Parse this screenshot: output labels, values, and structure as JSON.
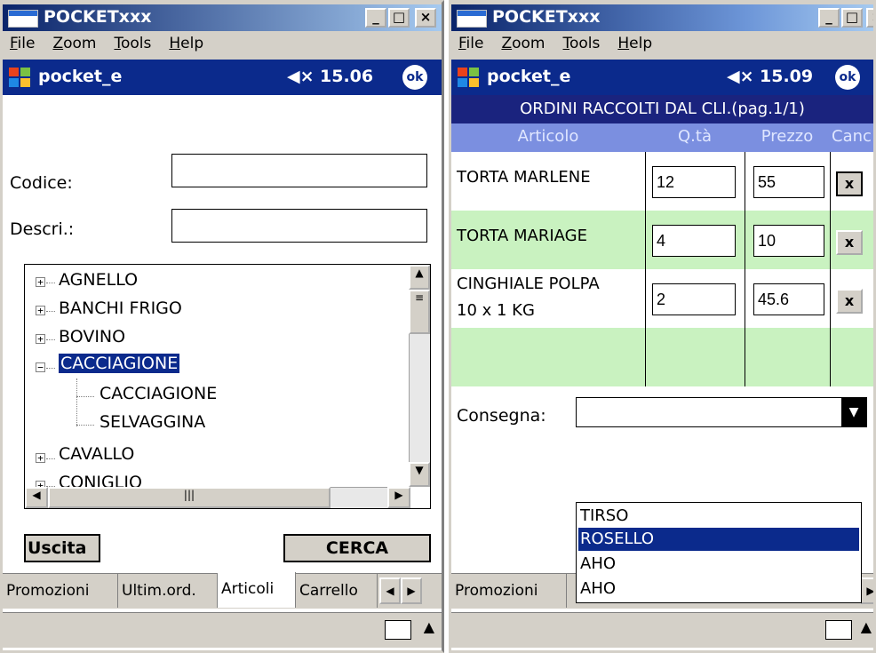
{
  "left": {
    "window_title": "POCKETxxx",
    "menu": [
      "File",
      "Zoom",
      "Tools",
      "Help"
    ],
    "app_name": "pocket_e",
    "clock": "15.06",
    "ok_label": "ok",
    "codice_label": "Codice:",
    "descr_label": "Descri.:",
    "codice_value": "",
    "descr_value": "",
    "tree": {
      "agnello": "AGNELLO",
      "banchi": "BANCHI FRIGO",
      "bovino": "BOVINO",
      "cacciagione": "CACCIAGIONE",
      "child_cacciagione": "CACCIAGIONE",
      "child_selvaggina": "SELVAGGINA",
      "cavallo": "CAVALLO",
      "coniglio": "CONIGLIO"
    },
    "uscita_label": "Uscita",
    "cerca_label": "CERCA",
    "tabs": [
      "Promozioni",
      "Ultim.ord.",
      "Articoli",
      "Carrello"
    ],
    "active_tab": "Articoli"
  },
  "right": {
    "window_title": "POCKETxxx",
    "menu": [
      "File",
      "Zoom",
      "Tools",
      "Help"
    ],
    "app_name": "pocket_e",
    "clock": "15.09",
    "ok_label": "ok",
    "orders_title": "ORDINI RACCOLTI DAL CLI.(pag.1/1)",
    "columns": [
      "Articolo",
      "Q.tà",
      "Prezzo",
      "Canc"
    ],
    "rows": [
      {
        "articolo": "TORTA MARLENE",
        "articolo2": "",
        "qta": "12",
        "prezzo": "55",
        "canc": "x"
      },
      {
        "articolo": "TORTA MARIAGE",
        "articolo2": "",
        "qta": "4",
        "prezzo": "10",
        "canc": "x"
      },
      {
        "articolo": "CINGHIALE POLPA",
        "articolo2": "10 x 1 KG",
        "qta": "2",
        "prezzo": "45.6",
        "canc": "x"
      }
    ],
    "consegna_label": "Consegna:",
    "consegna_value": "",
    "dropdown_options": [
      "TIRSO",
      "ROSELLO",
      "AHO",
      "AHO"
    ],
    "dropdown_selected": "ROSELLO",
    "tab_first": "Promozioni"
  },
  "colors": {
    "navbar": "#0b2a8c",
    "selection": "#0b2a8c",
    "header_row": "#1a237e",
    "column_header": "#7b8fe0",
    "row_highlight": "#c9f2c0",
    "chrome": "#d4d0c8"
  }
}
